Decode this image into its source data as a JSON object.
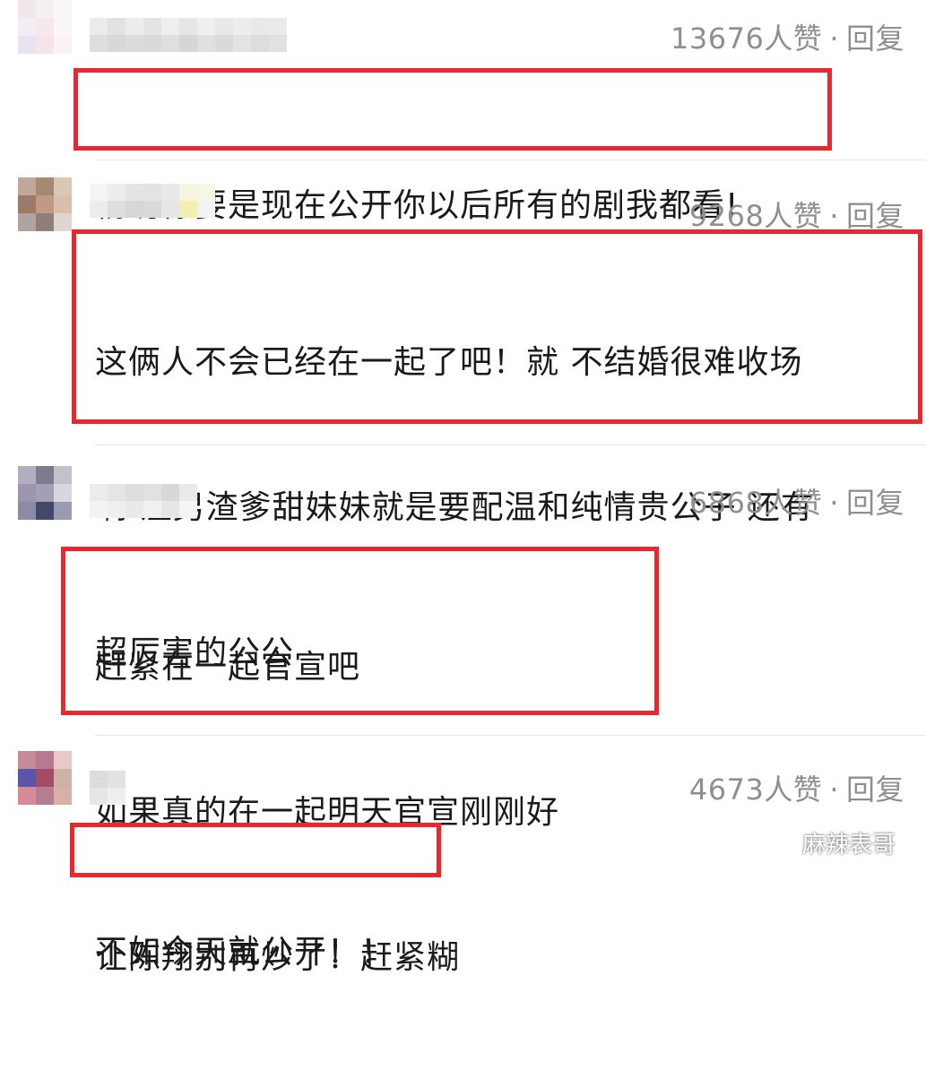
{
  "comments": [
    {
      "likes": "13676人赞",
      "separator": "·",
      "reply_label": "回复",
      "lines": [
        "杨玏你要是现在公开你以后所有的剧我都看!"
      ],
      "avatar_colors": [
        "#f1e8ec",
        "#f4f0f2",
        "#fbf7f9",
        "#f0eef3",
        "#f5e9ee",
        "#fbf6f8",
        "#e8e3ee",
        "#f6e4ea",
        "#faf2f5"
      ],
      "username_colors": [
        "#ebebeb",
        "#dedede",
        "#e2e2e2",
        "#d8d8d8",
        "#ececec",
        "#dcdcdc",
        "#e4e4e4",
        "#d9d9d9",
        "#eeeeee",
        "#dfdfdf",
        "#e6e6e6",
        "#d6d6d6",
        "#efefef",
        "#e0e0e0",
        "#e8e8e8",
        "#dadada",
        "#ededed",
        "#e3e3e3",
        "#e9e9e9",
        "#dddddd",
        "#eaeaea",
        "#e1e1e1"
      ]
    },
    {
      "likes": "9268人赞",
      "separator": "·",
      "reply_label": "回复",
      "lines": [
        "这俩人不会已经在一起了吧！就 不结婚很难收场",
        "啊 渣男渣爹甜妹妹就是要配温和纯情贵公子 还有",
        "超厉害的公公"
      ],
      "avatar_colors": [
        "#bfa89a",
        "#a68974",
        "#dcc6b6",
        "#9c7b6a",
        "#c09a84",
        "#d8bfae",
        "#b1a3a1",
        "#8f7e79",
        "#e1d5cf"
      ],
      "username_colors": [
        "#f4f4f4",
        "#ececec",
        "#ededed",
        "#dedede",
        "#e4e4e4",
        "#d7d7d7",
        "#e3e3e3",
        "#dadada",
        "#e9e9e9",
        "#e6e6e6",
        "#f7f5e2",
        "#f3efb1",
        "#f7f5e6",
        "#f2f2f2"
      ]
    },
    {
      "likes": "6868人赞",
      "separator": "·",
      "reply_label": "回复",
      "lines": [
        "赶紧在一起官宣吧",
        "如果真的在一起明天官宣刚刚好",
        "让陈翔别再炒了！赶紧糊"
      ],
      "avatar_colors": [
        "#b3adbd",
        "#7f7b8f",
        "#c6c0cc",
        "#9d95ad",
        "#a59fb5",
        "#dad6df",
        "#8f8aa4",
        "#43476b",
        "#9c9ab3"
      ],
      "username_colors": [
        "#ececec",
        "#f3f3f3",
        "#e5e5e5",
        "#eeeeee",
        "#dedede",
        "#e9e9e9",
        "#e1e1e1",
        "#f1f1f1",
        "#d8d8d8",
        "#e6e6e6",
        "#eaeaea",
        "#f4f4f4"
      ]
    },
    {
      "likes": "4673人赞",
      "separator": "·",
      "reply_label": "回复",
      "lines": [
        "不如今天就公开！！"
      ],
      "avatar_colors": [
        "#c78b97",
        "#b47a8d",
        "#e9c9c8",
        "#5b54ab",
        "#a44c63",
        "#cfb2a6",
        "#d88b97",
        "#b47e90",
        "#d9b0a8"
      ],
      "username_colors": [
        "#dcdcdc",
        "#e6e6e6",
        "#e2e2e2",
        "#efefef"
      ]
    }
  ],
  "watermark": {
    "text": "麻辣表哥",
    "icon": "wechat-icon"
  },
  "colors": {
    "highlight_border": "#e8282f",
    "meta_text": "#8f8f8f"
  }
}
